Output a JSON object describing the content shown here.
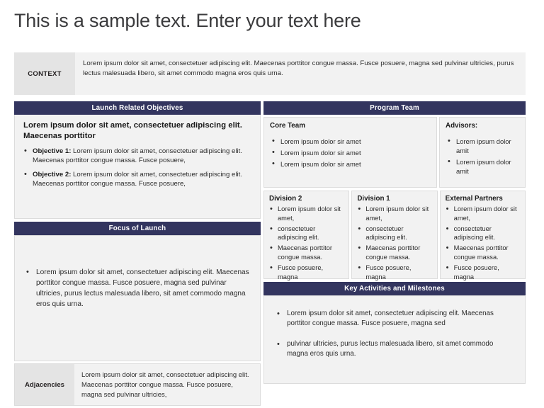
{
  "slide": {
    "title": "This is a sample text. Enter your text here",
    "accent_color": "#33355f",
    "panel_bg": "#f2f2f2",
    "label_bg": "#e4e4e4"
  },
  "context": {
    "label": "CONTEXT",
    "text": "Lorem ipsum dolor sit amet, consectetuer adipiscing elit. Maecenas porttitor congue massa. Fusce posuere, magna sed pulvinar ultricies, purus lectus malesuada libero, sit amet commodo magna eros quis urna."
  },
  "launch_objectives": {
    "header": "Launch Related Objectives",
    "lead": "Lorem ipsum dolor sit amet, consectetuer adipiscing elit. Maecenas porttitor",
    "bullets": [
      {
        "label": "Objective 1:",
        "text": " Lorem ipsum dolor sit amet, consectetuer adipiscing elit. Maecenas porttitor congue massa. Fusce posuere,"
      },
      {
        "label": "Objective 2:",
        "text": " Lorem ipsum dolor sit amet, consectetuer adipiscing elit. Maecenas porttitor congue massa. Fusce posuere,"
      }
    ]
  },
  "focus_of_launch": {
    "header": "Focus of Launch",
    "bullets": [
      "Lorem ipsum dolor sit amet, consectetuer adipiscing elit. Maecenas porttitor congue massa. Fusce posuere, magna sed pulvinar ultricies, purus lectus malesuada libero, sit amet commodo magna eros quis urna."
    ]
  },
  "adjacencies": {
    "label": "Adjacencies",
    "text": "Lorem ipsum dolor sit amet, consectetuer adipiscing elit. Maecenas porttitor congue massa. Fusce posuere, magna sed pulvinar ultricies,"
  },
  "program_team": {
    "header": "Program Team",
    "core_team": {
      "title": "Core Team",
      "bullets": [
        "Lorem ipsum dolor sir amet",
        "Lorem ipsum dolor sir amet",
        "Lorem ipsum dolor sir amet"
      ]
    },
    "advisors": {
      "title": "Advisors:",
      "bullets": [
        "Lorem ipsum dolor amit",
        "Lorem ipsum dolor amit"
      ]
    },
    "divisions": [
      {
        "title": "Division 2",
        "bullets": [
          "Lorem ipsum dolor sit amet,",
          "consectetuer adipiscing elit.",
          "Maecenas porttitor congue massa.",
          "Fusce posuere, magna"
        ]
      },
      {
        "title": "Division 1",
        "bullets": [
          "Lorem ipsum dolor sit amet,",
          "consectetuer adipiscing elit.",
          "Maecenas porttitor congue massa.",
          "Fusce posuere, magna"
        ]
      },
      {
        "title": "External Partners",
        "bullets": [
          "Lorem ipsum dolor sit amet,",
          "consectetuer adipiscing elit.",
          "Maecenas porttitor congue massa.",
          "Fusce posuere, magna"
        ]
      }
    ]
  },
  "key_activities": {
    "header": "Key Activities and Milestones",
    "bullets": [
      "Lorem ipsum dolor sit amet, consectetuer adipiscing elit. Maecenas porttitor congue massa. Fusce posuere, magna sed",
      "pulvinar ultricies, purus lectus malesuada libero, sit amet commodo magna eros quis urna."
    ]
  }
}
